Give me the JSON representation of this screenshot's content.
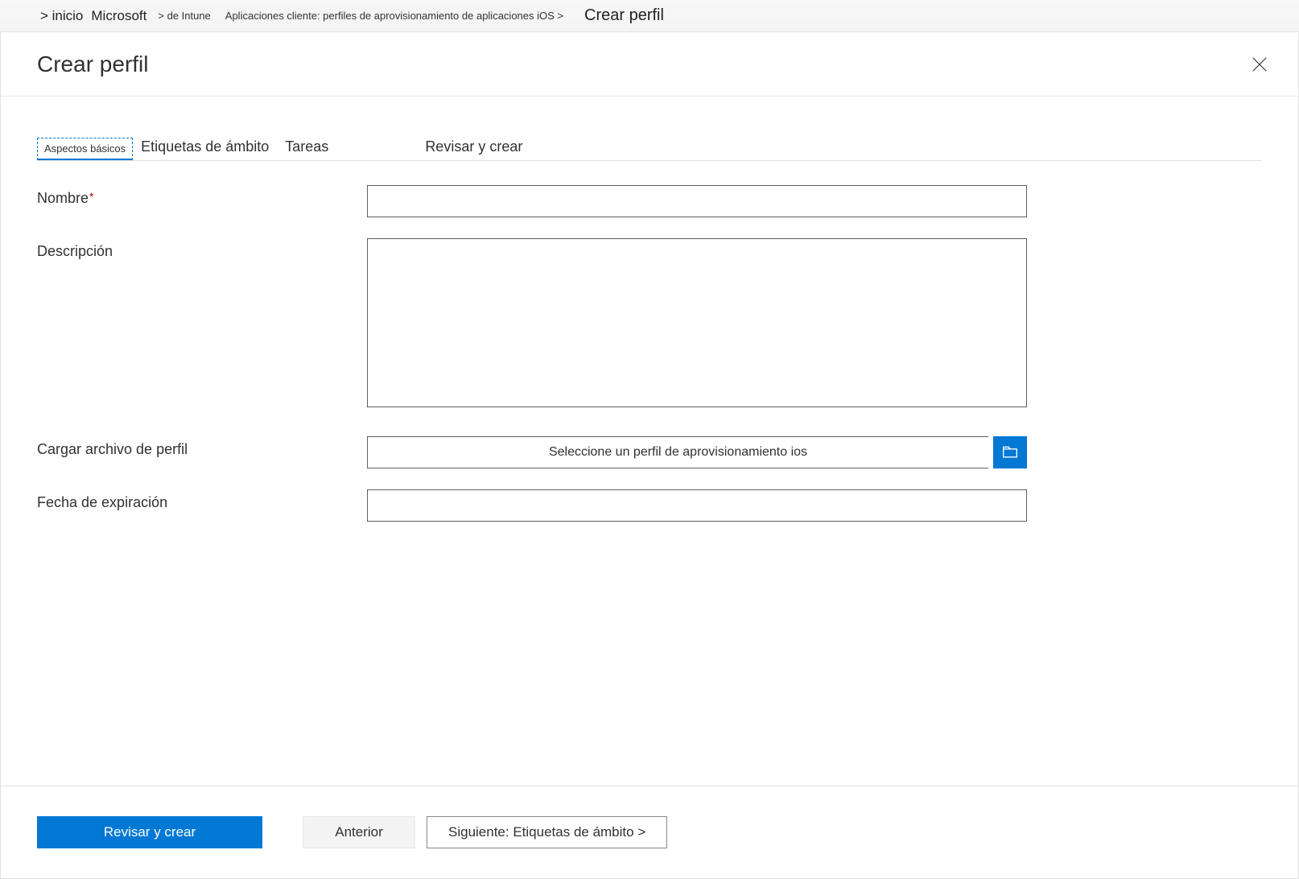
{
  "breadcrumb": {
    "items": [
      "&gt; inicio",
      "Microsoft",
      "&gt; de Intune",
      "Aplicaciones cliente: perfiles de aprovisionamiento de aplicaciones iOS &gt;",
      "Crear perfil"
    ]
  },
  "panel": {
    "title": "Crear perfil"
  },
  "tabs": {
    "basics": "Aspectos básicos",
    "scope": "Etiquetas de ámbito",
    "assignments": "Tareas",
    "review": "Revisar y crear"
  },
  "form": {
    "name_label": "Nombre",
    "name_value": "",
    "description_label": "Descripción",
    "description_value": "",
    "upload_label": "Cargar archivo de perfil",
    "upload_placeholder": "Seleccione un perfil de aprovisionamiento ios",
    "expiration_label": "Fecha de expiración",
    "expiration_value": ""
  },
  "footer": {
    "review": "Revisar y crear",
    "previous": "Anterior",
    "next": "Siguiente: Etiquetas de ámbito &gt;"
  }
}
